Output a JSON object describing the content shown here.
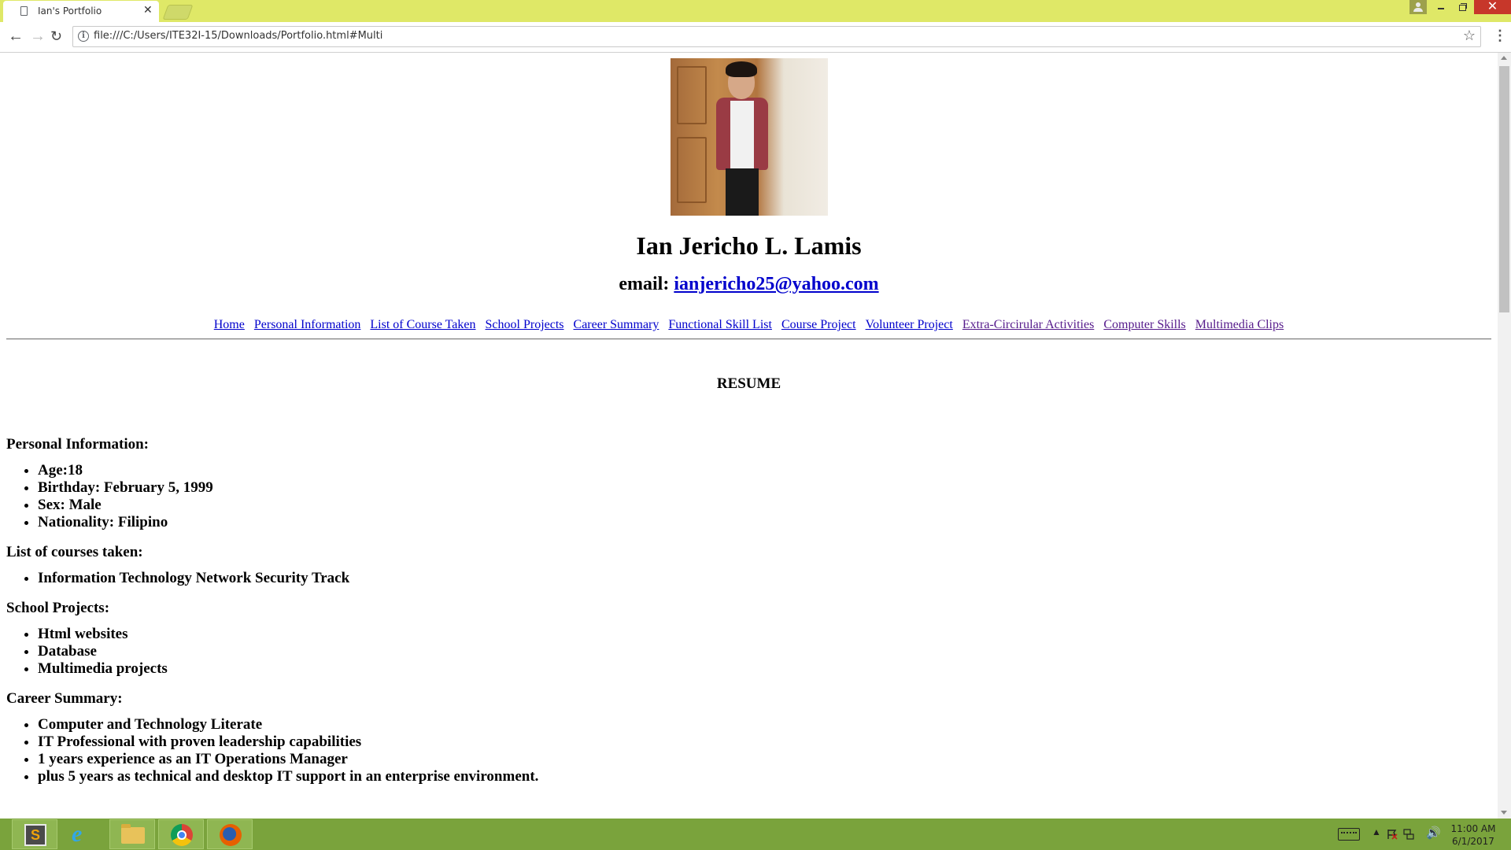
{
  "browser": {
    "tab_title": "Ian's Portfolio",
    "tab_close": "✕",
    "url": "file:///C:/Users/ITE32I-15/Downloads/Portfolio.html#Multi",
    "accent_color": "#dfe867"
  },
  "page": {
    "name": "Ian Jericho L. Lamis",
    "email_label": "email:",
    "email": "ianjericho25@yahoo.com",
    "nav_links": [
      "Home",
      "Personal Information",
      "List of Course Taken",
      "School Projects",
      "Career Summary",
      "Functional Skill List",
      "Course Project",
      "Volunteer Project",
      "Extra-Circirular Activities",
      "Computer Skills",
      "Multimedia Clips"
    ],
    "resume_heading": "RESUME",
    "sections": [
      {
        "title": "Personal Information:",
        "items": [
          "Age:18",
          "Birthday: February 5, 1999",
          "Sex: Male",
          "Nationality: Filipino"
        ]
      },
      {
        "title": "List of courses taken:",
        "items": [
          "Information Technology Network Security Track"
        ]
      },
      {
        "title": "School Projects:",
        "items": [
          "Html websites",
          "Database",
          "Multimedia projects"
        ]
      },
      {
        "title": "Career Summary:",
        "items": [
          "Computer and Technology Literate",
          "IT Professional with proven leadership capabilities",
          "1 years experience as an IT Operations Manager",
          "plus 5 years as technical and desktop IT support in an enterprise environment."
        ]
      }
    ]
  },
  "taskbar": {
    "apps": [
      "sublime-text-icon",
      "internet-explorer-icon",
      "file-explorer-icon",
      "chrome-icon",
      "firefox-icon"
    ],
    "time": "11:00 AM",
    "date": "6/1/2017",
    "color": "#7aa33c"
  }
}
